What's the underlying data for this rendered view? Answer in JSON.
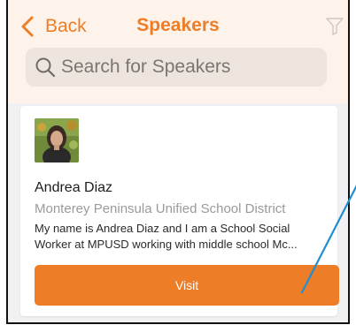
{
  "header": {
    "back_label": "Back",
    "title": "Speakers",
    "filter_icon": "filter-icon",
    "accent_color": "#ee7d28"
  },
  "search": {
    "placeholder": "Search for Speakers",
    "icon": "search-icon"
  },
  "speaker_card": {
    "name": "Andrea Diaz",
    "organization": "Monterey Peninsula Unified School District",
    "bio_line_1": "My name is Andrea Diaz and I am a School Social",
    "bio_line_2": "Worker at MPUSD working with middle school Mc...",
    "button_label": "Visit"
  }
}
